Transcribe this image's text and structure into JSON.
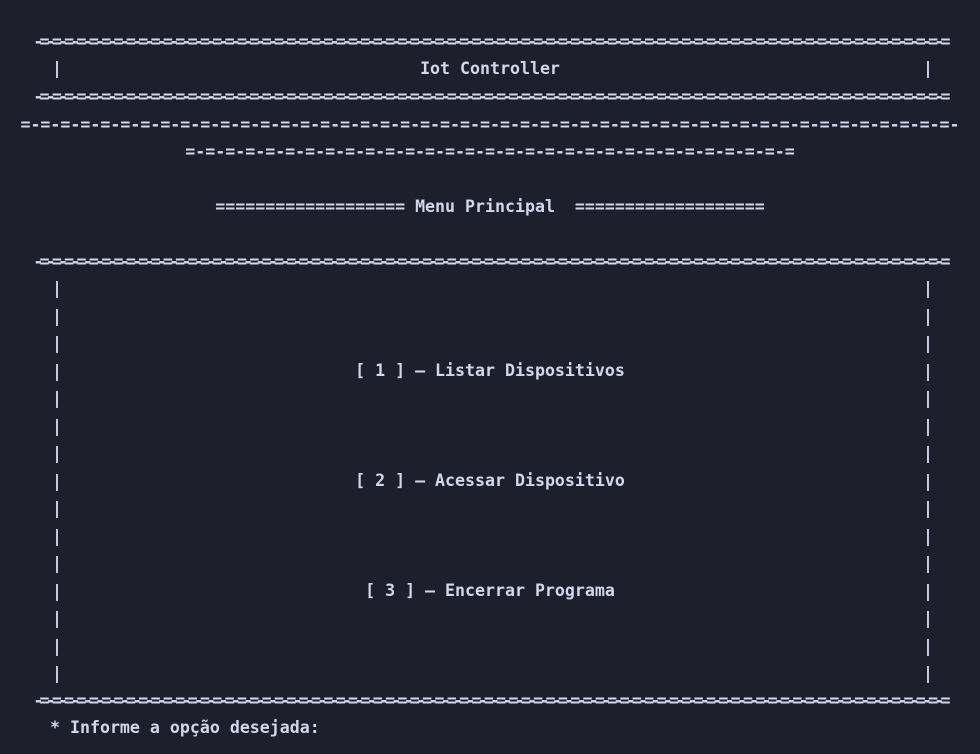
{
  "header": {
    "border": "-=-=-=-=-=-=-=-=-=-=-=-=-=-=-=-=-=-=-=-=-=-=-=-=-=-=-=-=-=-=-=-=-=-=-=-=-=-=-=-=-=-=-=-=-=-=-=-=-=-=-=-=-=-=-=-=-=-=-=-=-=-=-=-=-=-=-=-=-=-=-=-=-=-=",
    "title": "Iot Controller",
    "deco_medium": "=-=-=-=-=-=-=-=-=-=-=-=-=-=-=-=-=-=-=-=-=-=-=-=-=-=-=-=-=-=-=-=-=-=-=-=-=-=-=-=-=-=-=-=-=-=-=-",
    "deco_short": "=-=-=-=-=-=-=-=-=-=-=-=-=-=-=-=-=-=-=-=-=-=-=-=-=-=-=-=-=-=-="
  },
  "menu": {
    "heading": "=================== Menu Principal  ===================",
    "border": "-=-=-=-=-=-=-=-=-=-=-=-=-=-=-=-=-=-=-=-=-=-=-=-=-=-=-=-=-=-=-=-=-=-=-=-=-=-=-=-=-=-=-=-=-=-=-=-=-=-=-=-=-=-=-=-=-=-=-=-=-=-=-=-=-=-=-=-=-=-=-=-=-=-=",
    "side_char": "|",
    "options": [
      {
        "label": "[ 1 ] — Listar Dispositivos"
      },
      {
        "label": "[ 2 ] — Acessar Dispositivo"
      },
      {
        "label": "[ 3 ] — Encerrar Programa"
      }
    ]
  },
  "prompt": {
    "text": "* Informe a opção desejada:",
    "value": ""
  },
  "colors": {
    "background": "#1e1f2d",
    "foreground": "#d4d7ec"
  }
}
